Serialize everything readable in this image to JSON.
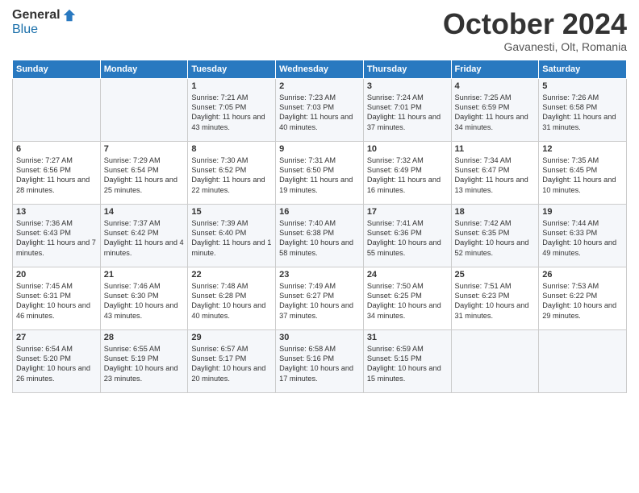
{
  "logo": {
    "general": "General",
    "blue": "Blue"
  },
  "header": {
    "month": "October 2024",
    "location": "Gavanesti, Olt, Romania"
  },
  "days_of_week": [
    "Sunday",
    "Monday",
    "Tuesday",
    "Wednesday",
    "Thursday",
    "Friday",
    "Saturday"
  ],
  "weeks": [
    [
      {
        "day": "",
        "content": ""
      },
      {
        "day": "",
        "content": ""
      },
      {
        "day": "1",
        "content": "Sunrise: 7:21 AM\nSunset: 7:05 PM\nDaylight: 11 hours and 43 minutes."
      },
      {
        "day": "2",
        "content": "Sunrise: 7:23 AM\nSunset: 7:03 PM\nDaylight: 11 hours and 40 minutes."
      },
      {
        "day": "3",
        "content": "Sunrise: 7:24 AM\nSunset: 7:01 PM\nDaylight: 11 hours and 37 minutes."
      },
      {
        "day": "4",
        "content": "Sunrise: 7:25 AM\nSunset: 6:59 PM\nDaylight: 11 hours and 34 minutes."
      },
      {
        "day": "5",
        "content": "Sunrise: 7:26 AM\nSunset: 6:58 PM\nDaylight: 11 hours and 31 minutes."
      }
    ],
    [
      {
        "day": "6",
        "content": "Sunrise: 7:27 AM\nSunset: 6:56 PM\nDaylight: 11 hours and 28 minutes."
      },
      {
        "day": "7",
        "content": "Sunrise: 7:29 AM\nSunset: 6:54 PM\nDaylight: 11 hours and 25 minutes."
      },
      {
        "day": "8",
        "content": "Sunrise: 7:30 AM\nSunset: 6:52 PM\nDaylight: 11 hours and 22 minutes."
      },
      {
        "day": "9",
        "content": "Sunrise: 7:31 AM\nSunset: 6:50 PM\nDaylight: 11 hours and 19 minutes."
      },
      {
        "day": "10",
        "content": "Sunrise: 7:32 AM\nSunset: 6:49 PM\nDaylight: 11 hours and 16 minutes."
      },
      {
        "day": "11",
        "content": "Sunrise: 7:34 AM\nSunset: 6:47 PM\nDaylight: 11 hours and 13 minutes."
      },
      {
        "day": "12",
        "content": "Sunrise: 7:35 AM\nSunset: 6:45 PM\nDaylight: 11 hours and 10 minutes."
      }
    ],
    [
      {
        "day": "13",
        "content": "Sunrise: 7:36 AM\nSunset: 6:43 PM\nDaylight: 11 hours and 7 minutes."
      },
      {
        "day": "14",
        "content": "Sunrise: 7:37 AM\nSunset: 6:42 PM\nDaylight: 11 hours and 4 minutes."
      },
      {
        "day": "15",
        "content": "Sunrise: 7:39 AM\nSunset: 6:40 PM\nDaylight: 11 hours and 1 minute."
      },
      {
        "day": "16",
        "content": "Sunrise: 7:40 AM\nSunset: 6:38 PM\nDaylight: 10 hours and 58 minutes."
      },
      {
        "day": "17",
        "content": "Sunrise: 7:41 AM\nSunset: 6:36 PM\nDaylight: 10 hours and 55 minutes."
      },
      {
        "day": "18",
        "content": "Sunrise: 7:42 AM\nSunset: 6:35 PM\nDaylight: 10 hours and 52 minutes."
      },
      {
        "day": "19",
        "content": "Sunrise: 7:44 AM\nSunset: 6:33 PM\nDaylight: 10 hours and 49 minutes."
      }
    ],
    [
      {
        "day": "20",
        "content": "Sunrise: 7:45 AM\nSunset: 6:31 PM\nDaylight: 10 hours and 46 minutes."
      },
      {
        "day": "21",
        "content": "Sunrise: 7:46 AM\nSunset: 6:30 PM\nDaylight: 10 hours and 43 minutes."
      },
      {
        "day": "22",
        "content": "Sunrise: 7:48 AM\nSunset: 6:28 PM\nDaylight: 10 hours and 40 minutes."
      },
      {
        "day": "23",
        "content": "Sunrise: 7:49 AM\nSunset: 6:27 PM\nDaylight: 10 hours and 37 minutes."
      },
      {
        "day": "24",
        "content": "Sunrise: 7:50 AM\nSunset: 6:25 PM\nDaylight: 10 hours and 34 minutes."
      },
      {
        "day": "25",
        "content": "Sunrise: 7:51 AM\nSunset: 6:23 PM\nDaylight: 10 hours and 31 minutes."
      },
      {
        "day": "26",
        "content": "Sunrise: 7:53 AM\nSunset: 6:22 PM\nDaylight: 10 hours and 29 minutes."
      }
    ],
    [
      {
        "day": "27",
        "content": "Sunrise: 6:54 AM\nSunset: 5:20 PM\nDaylight: 10 hours and 26 minutes."
      },
      {
        "day": "28",
        "content": "Sunrise: 6:55 AM\nSunset: 5:19 PM\nDaylight: 10 hours and 23 minutes."
      },
      {
        "day": "29",
        "content": "Sunrise: 6:57 AM\nSunset: 5:17 PM\nDaylight: 10 hours and 20 minutes."
      },
      {
        "day": "30",
        "content": "Sunrise: 6:58 AM\nSunset: 5:16 PM\nDaylight: 10 hours and 17 minutes."
      },
      {
        "day": "31",
        "content": "Sunrise: 6:59 AM\nSunset: 5:15 PM\nDaylight: 10 hours and 15 minutes."
      },
      {
        "day": "",
        "content": ""
      },
      {
        "day": "",
        "content": ""
      }
    ]
  ]
}
